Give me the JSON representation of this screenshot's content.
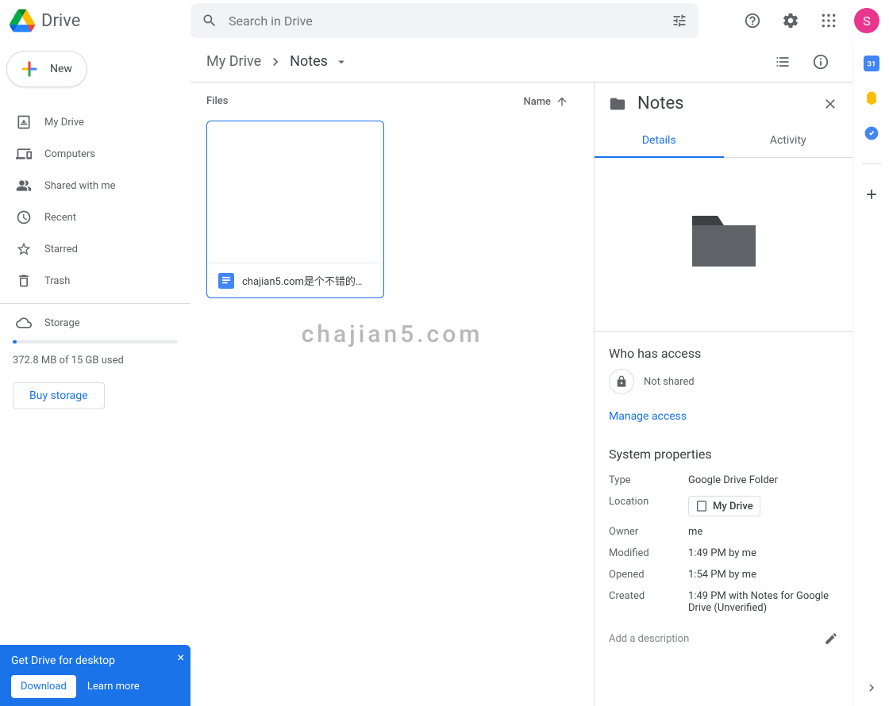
{
  "header": {
    "app_name": "Drive",
    "search_placeholder": "Search in Drive",
    "avatar_initial": "S"
  },
  "sidebar": {
    "new_label": "New",
    "items": [
      {
        "label": "My Drive"
      },
      {
        "label": "Computers"
      },
      {
        "label": "Shared with me"
      },
      {
        "label": "Recent"
      },
      {
        "label": "Starred"
      },
      {
        "label": "Trash"
      }
    ],
    "storage_label": "Storage",
    "storage_used": "372.8 MB of 15 GB used",
    "buy_label": "Buy storage"
  },
  "breadcrumb": {
    "root": "My Drive",
    "current": "Notes"
  },
  "columns": {
    "files": "Files",
    "name": "Name"
  },
  "files": [
    {
      "name": "chajian5.com是个不错的…"
    }
  ],
  "watermark": "chajian5.com",
  "details": {
    "title": "Notes",
    "tabs": {
      "details": "Details",
      "activity": "Activity"
    },
    "access_heading": "Who has access",
    "access_text": "Not shared",
    "manage_link": "Manage access",
    "sys_heading": "System properties",
    "props": {
      "type_k": "Type",
      "type_v": "Google Drive Folder",
      "location_k": "Location",
      "location_v": "My Drive",
      "owner_k": "Owner",
      "owner_v": "me",
      "modified_k": "Modified",
      "modified_v": "1:49 PM by me",
      "opened_k": "Opened",
      "opened_v": "1:54 PM by me",
      "created_k": "Created",
      "created_v": "1:49 PM with Notes for Google Drive (Unverified)"
    },
    "desc_placeholder": "Add a description"
  },
  "snackbar": {
    "title": "Get Drive for desktop",
    "download": "Download",
    "learn": "Learn more"
  }
}
